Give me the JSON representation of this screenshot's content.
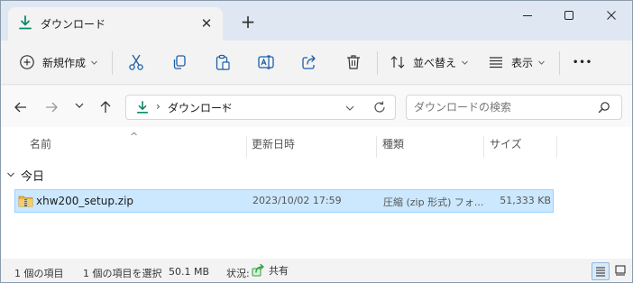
{
  "tab": {
    "title": "ダウンロード",
    "close_glyph": "✕",
    "new_tab_glyph": "+"
  },
  "window_controls": [
    "minimize-icon",
    "maximize-icon",
    "close-icon"
  ],
  "toolbar": {
    "new_label": "新規作成",
    "sort_label": "並べ替え",
    "view_label": "表示",
    "more_glyph": "•••",
    "icons": [
      "cut-icon",
      "copy-icon",
      "paste-icon",
      "rename-icon",
      "share-icon",
      "delete-icon"
    ]
  },
  "address": {
    "path": "ダウンロード",
    "separator": "›"
  },
  "search": {
    "placeholder": "ダウンロードの検索"
  },
  "columns": {
    "name": "名前",
    "date": "更新日時",
    "type": "種類",
    "size": "サイズ",
    "sort_glyph": "^"
  },
  "group": {
    "label": "今日"
  },
  "files": [
    {
      "name": "xhw200_setup.zip",
      "date": "2023/10/02 17:59",
      "type": "圧縮 (zip 形式) フォ...",
      "size": "51,333 KB"
    }
  ],
  "status": {
    "item_count": "1 個の項目",
    "selected": "1 個の項目を選択",
    "selected_size": "50.1 MB",
    "state_label": "状況:",
    "share_label": "共有"
  },
  "colors": {
    "accent": "#0a8a6a",
    "selection": "#cce8ff",
    "selection_border": "#99d1ff"
  }
}
